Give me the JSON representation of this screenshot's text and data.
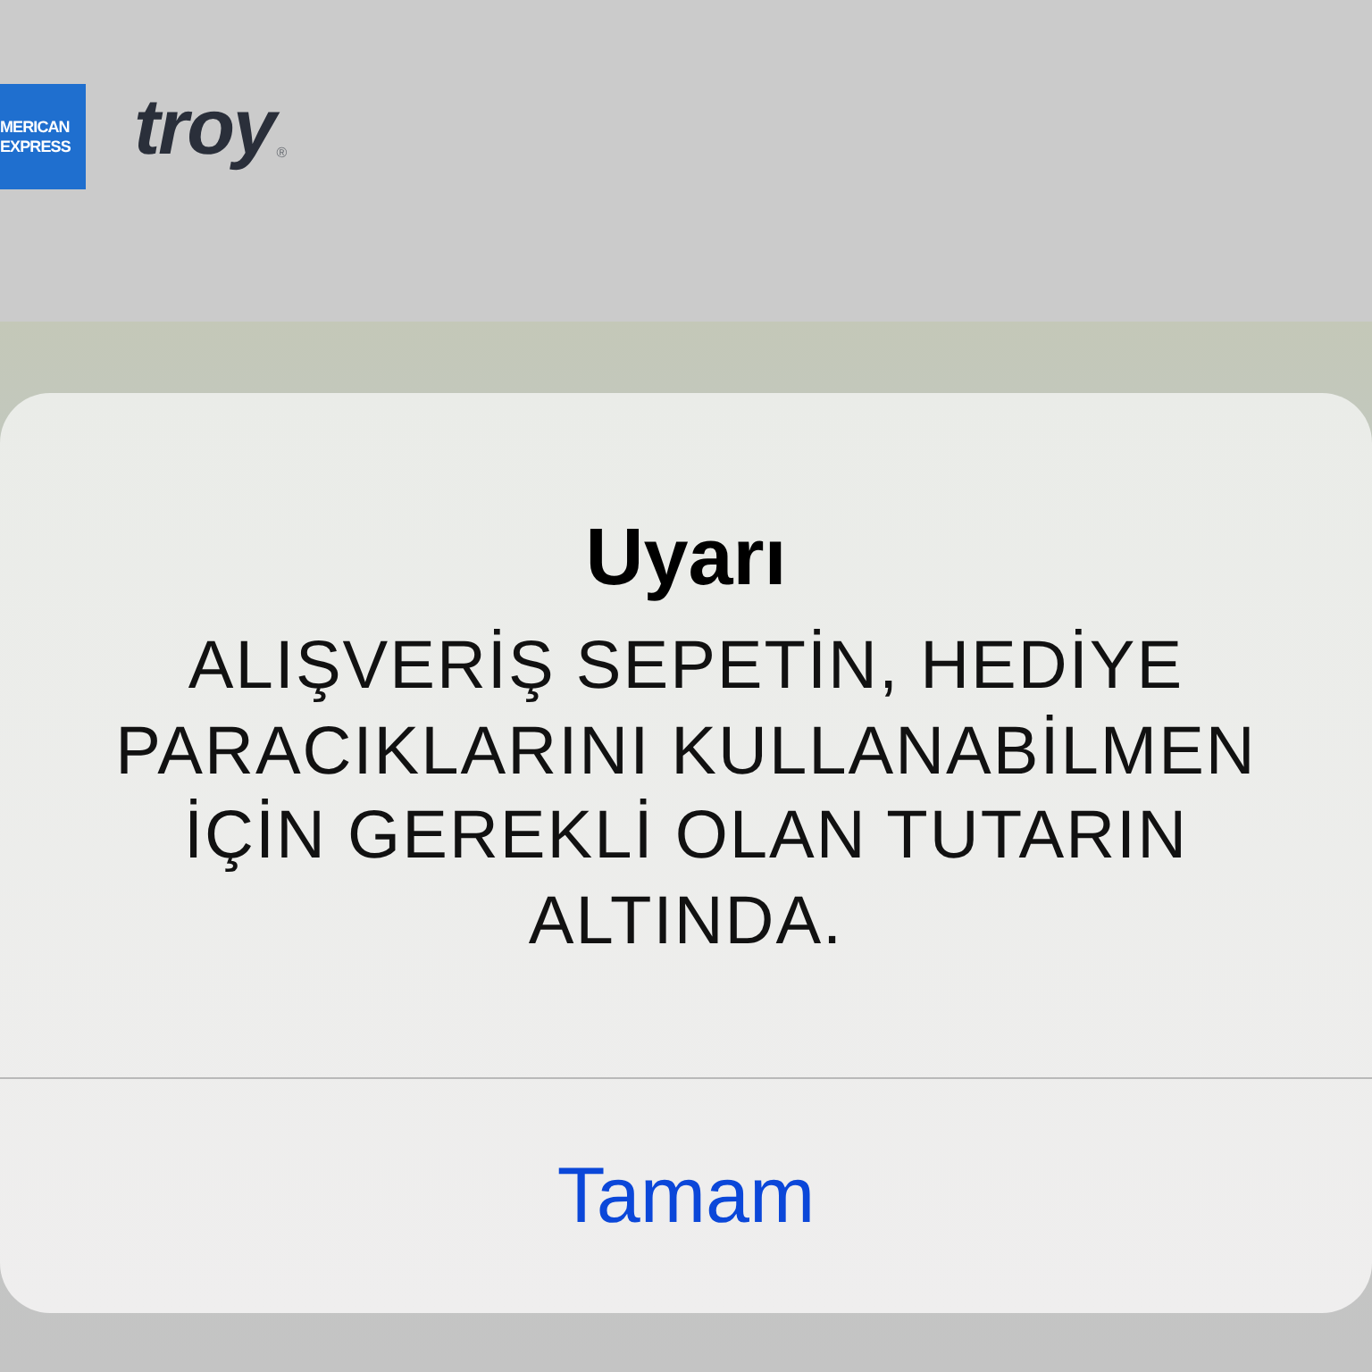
{
  "payment_logos": [
    {
      "kind": "amex",
      "lines": [
        "MERICAN",
        "EXPRESS"
      ]
    },
    {
      "kind": "troy",
      "text": "troy",
      "mark": "®"
    }
  ],
  "alert": {
    "title": "Uyarı",
    "message": "ALIŞVERİŞ SEPETİN, HEDİYE PARACIKLARINI KULLANABİLMEN İÇİN GEREKLİ OLAN TUTARIN ALTINDA.",
    "buttons": [
      "Tamam"
    ]
  }
}
